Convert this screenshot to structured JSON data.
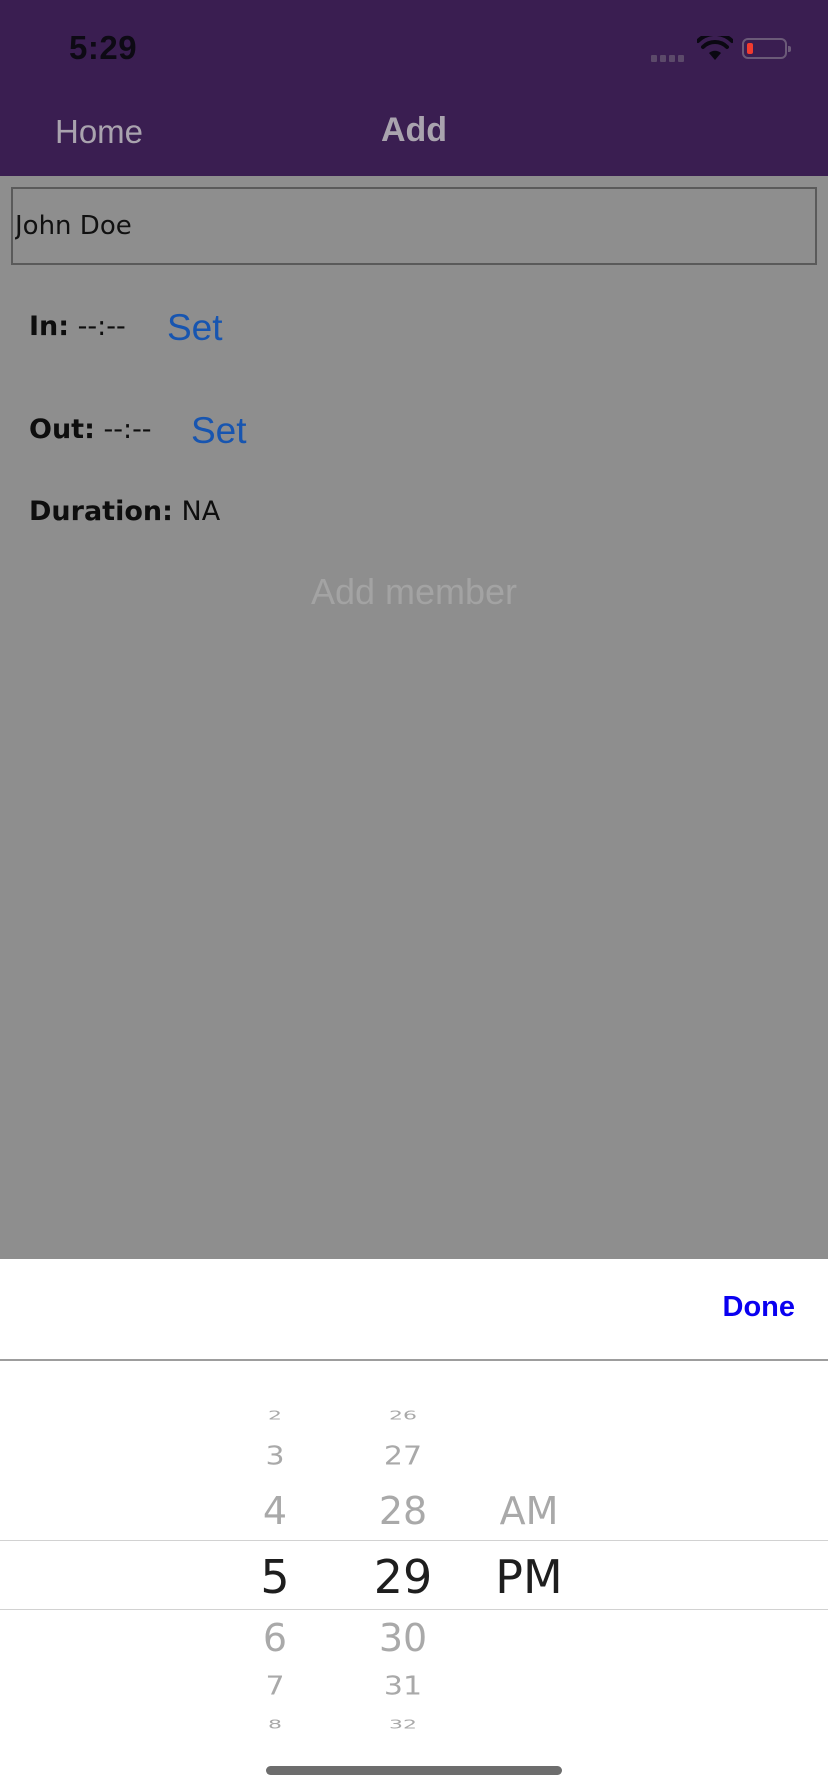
{
  "status_bar": {
    "time": "5:29",
    "battery_level": 0.1,
    "battery_color": "#f23b2f"
  },
  "nav": {
    "home_label": "Home",
    "title": "Add",
    "bar_color": "#3a1e51"
  },
  "form": {
    "name_value": "John Doe",
    "in_label": "In:",
    "in_value": "--:--",
    "in_set_label": "Set",
    "out_label": "Out:",
    "out_value": "--:--",
    "out_set_label": "Set",
    "duration_label": "Duration:",
    "duration_value": "NA",
    "add_member_label": "Add member",
    "link_color": "#1755b0"
  },
  "picker": {
    "done_label": "Done",
    "done_color": "#0a00f0",
    "hours": [
      "2",
      "3",
      "4",
      "5",
      "6",
      "7",
      "8"
    ],
    "minutes": [
      "26",
      "27",
      "28",
      "29",
      "30",
      "31",
      "32"
    ],
    "meridiem": [
      "AM",
      "PM"
    ],
    "selected_hour": "5",
    "selected_minute": "29",
    "selected_meridiem": "PM"
  }
}
